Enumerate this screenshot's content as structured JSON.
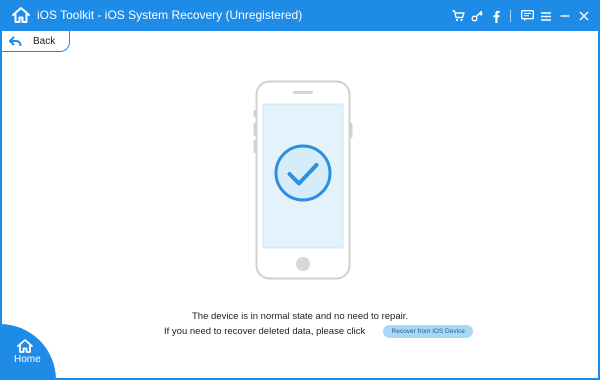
{
  "window": {
    "title": "iOS Toolkit - iOS System Recovery (Unregistered)",
    "accent_color": "#1e8be6"
  },
  "titlebar": {
    "home_icon": "home-icon",
    "tools": [
      "cart-icon",
      "key-icon",
      "facebook-icon",
      "feedback-icon",
      "menu-icon",
      "minimize-icon",
      "close-icon"
    ]
  },
  "nav": {
    "back_label": "Back"
  },
  "main": {
    "status_message": "The device is in normal state and no need to repair.",
    "recover_prompt": "If you need to recover deleted data, please click",
    "recover_button_label": "Recover from iOS Device"
  },
  "footer": {
    "home_label": "Home"
  }
}
